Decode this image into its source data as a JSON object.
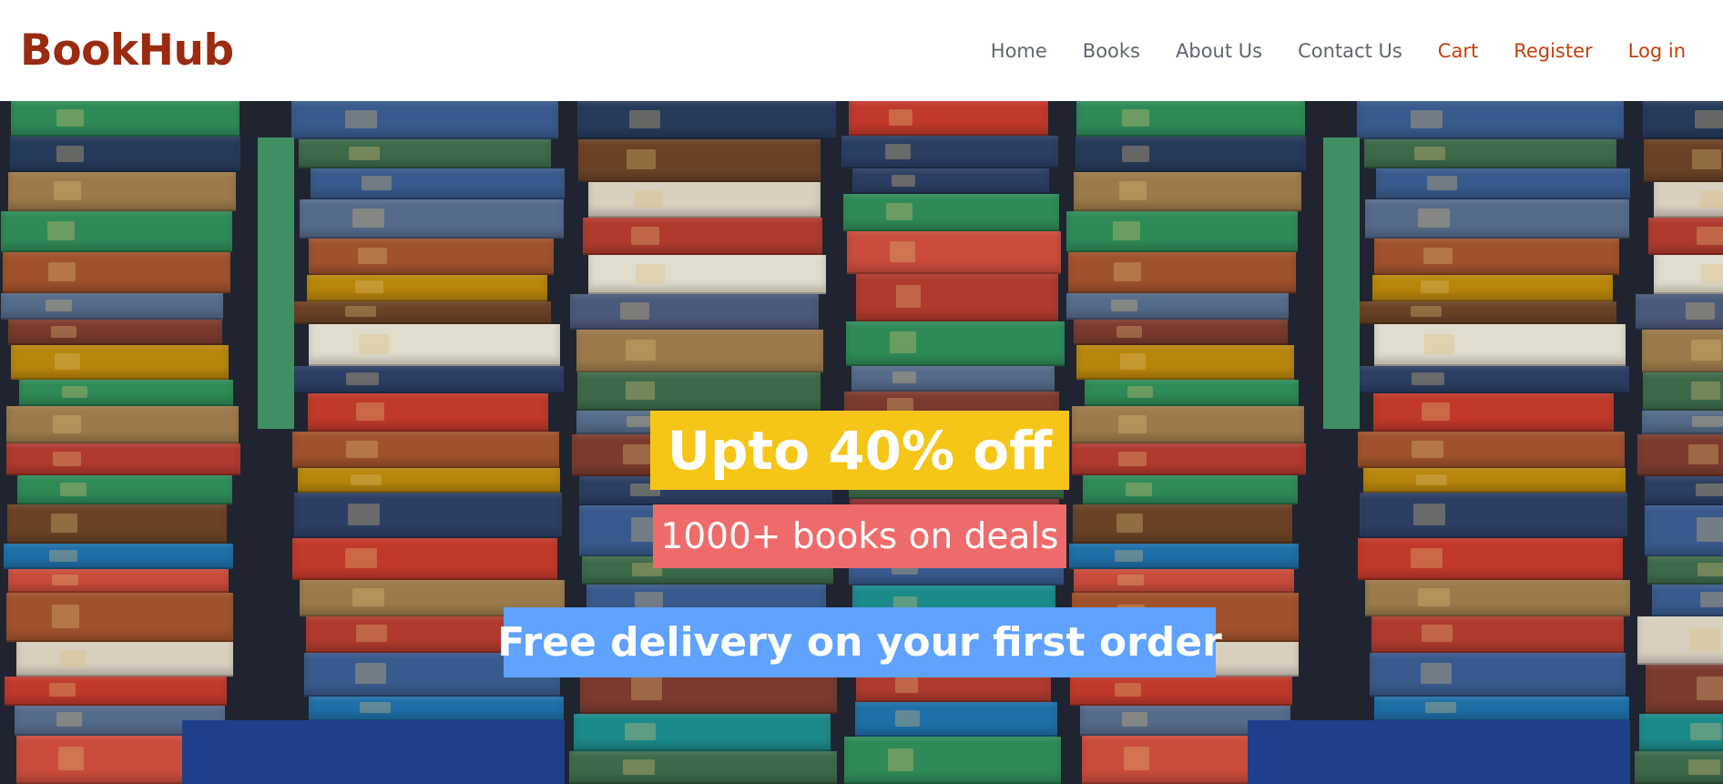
{
  "header": {
    "logo": "BookHub",
    "nav": {
      "home": "Home",
      "books": "Books",
      "about": "About Us",
      "contact": "Contact Us",
      "cart": "Cart",
      "register": "Register",
      "login": "Log in"
    }
  },
  "hero": {
    "image_description_icon": "stacked-books-image",
    "offer_title": "Upto 40% off",
    "offer_subtitle": "1000+ books on deals",
    "delivery_text": "Free delivery on your first order"
  },
  "colors": {
    "brand": "#9a2b10",
    "nav_text": "#5f6573",
    "nav_accent": "#c2410c",
    "banner_yellow": "#f5c518",
    "banner_red": "#ef6b6b",
    "banner_blue": "#5fa2ff"
  }
}
